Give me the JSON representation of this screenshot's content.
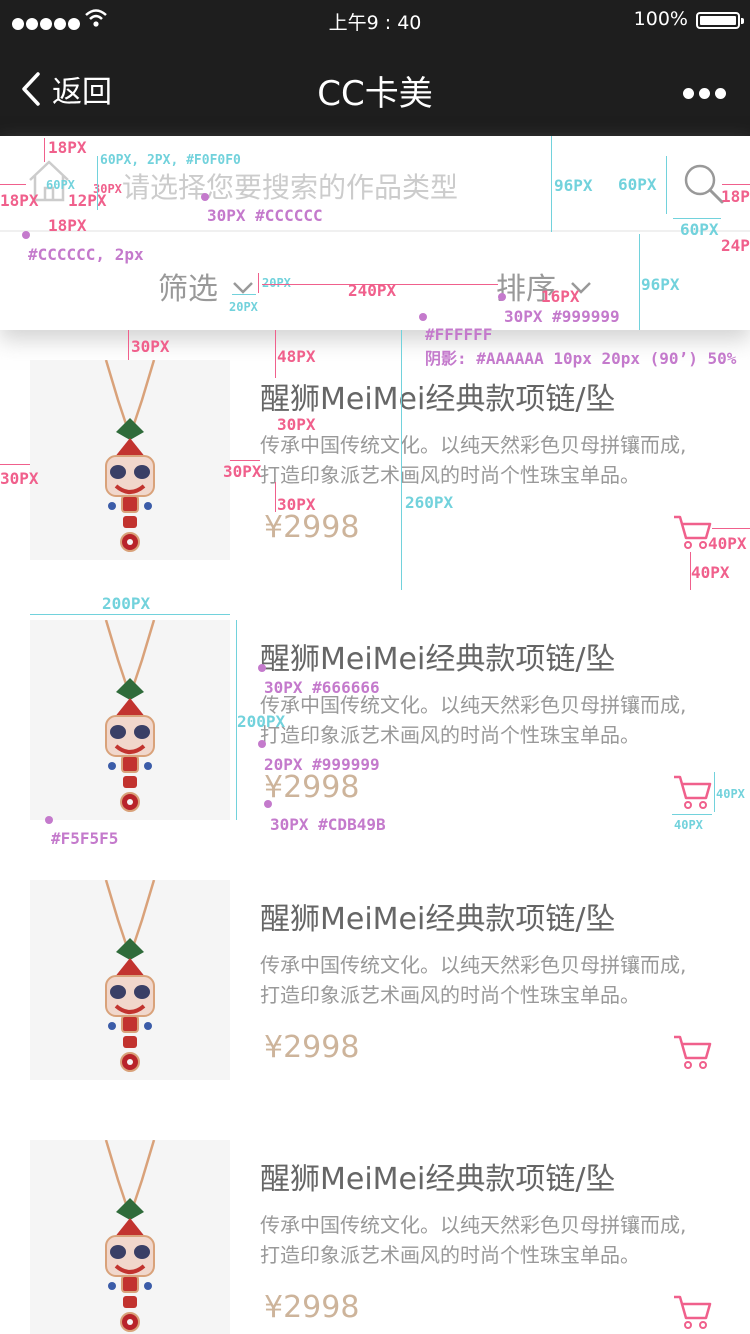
{
  "status_bar": {
    "time": "上午9 : 40",
    "battery_percent": "100%",
    "signal_bars": 5
  },
  "nav": {
    "back_label": "返回",
    "title": "CC卡美"
  },
  "search": {
    "placeholder": "请选择您要搜索的作品类型"
  },
  "filters": {
    "filter_label": "筛选",
    "sort_label": "排序"
  },
  "products": [
    {
      "name": "醒狮MeiMei经典款项链/坠",
      "desc_line1": "传承中国传统文化。以纯天然彩色贝母拼镶而成,",
      "desc_line2": "打造印象派艺术画风的时尚个性珠宝单品。",
      "price": "¥2998"
    },
    {
      "name": "醒狮MeiMei经典款项链/坠",
      "desc_line1": "传承中国传统文化。以纯天然彩色贝母拼镶而成,",
      "desc_line2": "打造印象派艺术画风的时尚个性珠宝单品。",
      "price": "¥2998"
    },
    {
      "name": "醒狮MeiMei经典款项链/坠",
      "desc_line1": "传承中国传统文化。以纯天然彩色贝母拼镶而成,",
      "desc_line2": "打造印象派艺术画风的时尚个性珠宝单品。",
      "price": "¥2998"
    },
    {
      "name": "醒狮MeiMei经典款项链/坠",
      "desc_line1": "传承中国传统文化。以纯天然彩色贝母拼镶而成,",
      "desc_line2": "打造印象派艺术画风的时尚个性珠宝单品。",
      "price": "¥2998"
    }
  ],
  "colors": {
    "nav_bg": "#1E1E1E",
    "panel_bg": "#FFFFFF",
    "image_bg": "#F5F5F5",
    "name": "#666666",
    "desc": "#999999",
    "price": "#CDB49B",
    "placeholder": "#CCCCCC",
    "cart": "#F0608C"
  },
  "icons": {
    "back": "chevron-left-icon",
    "more": "ellipsis-icon",
    "home": "home-icon",
    "search": "search-icon",
    "dropdown": "chevron-down-icon",
    "cart": "cart-icon"
  },
  "annotations": {
    "a_18px_top": "18PX",
    "a_18px_left": "18PX",
    "a_60px_small": "60PX",
    "a_12px": "12PX",
    "a_30px_small": "30PX",
    "a_18px_bottom": "18PX",
    "a_input_spec": "60PX, 2PX, #F0F0F0",
    "a_placeholder_spec": "30PX #CCCCCC",
    "a_96px_1": "96PX",
    "a_60px_1": "60PX",
    "a_18px_right": "18PX",
    "a_60px_2": "60PX",
    "a_24px": "24PX",
    "a_divider_spec": "#CCCCCC, 2px",
    "a_20px_1": "20PX",
    "a_20px_2": "20PX",
    "a_240px": "240PX",
    "a_16px": "16PX",
    "a_filter_spec": "30PX #999999",
    "a_96px_2": "96PX",
    "a_panel_bg": "#FFFFFF",
    "a_shadow": "阴影: #AAAAAA 10px 20px (90’) 50%",
    "a_30px_1": "30PX",
    "a_48px": "48PX",
    "a_30px_2": "30PX",
    "a_30px_3": "30PX",
    "a_30px_4": "30PX",
    "a_30px_5": "30PX",
    "a_260px": "260PX",
    "a_40px_1": "40PX",
    "a_40px_2": "40PX",
    "a_200px_w": "200PX",
    "a_200px_h": "200PX",
    "a_name_spec": "30PX #666666",
    "a_desc_spec": "20PX #999999",
    "a_price_spec": "30PX #CDB49B",
    "a_img_bg": "#F5F5F5",
    "a_40px_3": "40PX",
    "a_40px_4": "40PX"
  }
}
